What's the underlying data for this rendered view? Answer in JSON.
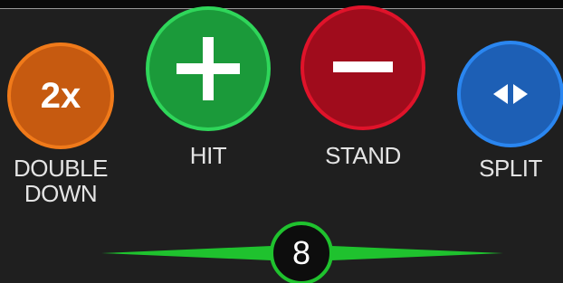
{
  "actions": {
    "double_down": {
      "icon_text": "2x",
      "label": "DOUBLE\nDOWN",
      "color": "#c65a10"
    },
    "hit": {
      "icon": "plus-icon",
      "label": "HIT",
      "color": "#1b9a3a"
    },
    "stand": {
      "icon": "minus-icon",
      "label": "STAND",
      "color": "#a00c1c"
    },
    "split": {
      "icon": "split-arrows-icon",
      "label": "SPLIT",
      "color": "#1d5fb5"
    }
  },
  "hand_total": {
    "value": "8",
    "accent": "#1fc22e"
  }
}
